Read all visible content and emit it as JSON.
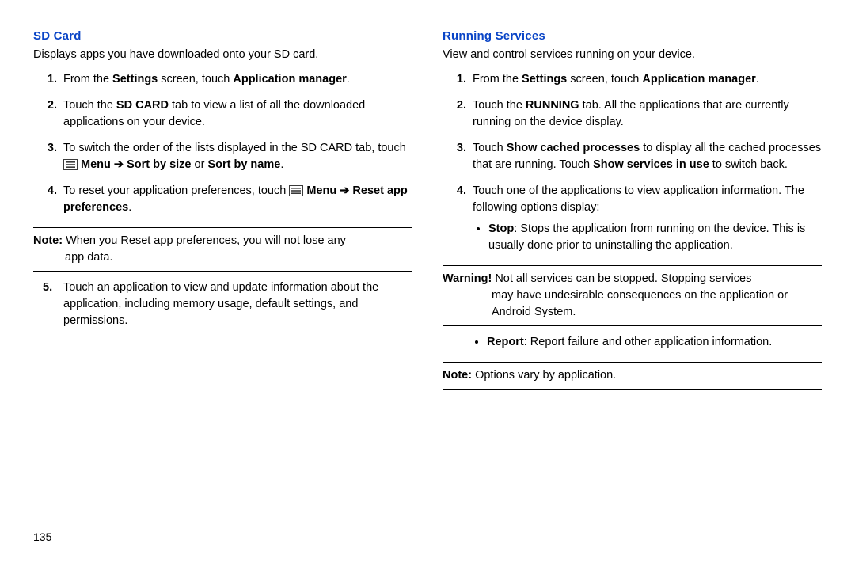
{
  "left": {
    "heading": "SD Card",
    "intro": "Displays apps you have downloaded onto your SD card.",
    "s1a": "From the ",
    "s1b": "Settings",
    "s1c": " screen, touch ",
    "s1d": "Application manager",
    "s1e": ".",
    "s2a": "Touch the ",
    "s2b": "SD CARD",
    "s2c": " tab to view a list of all the downloaded applications on your device.",
    "s3a": "To switch the order of the lists displayed in the SD CARD tab, touch ",
    "s3menu": " Menu ",
    "s3arrow": "➔",
    "s3b": " Sort by size",
    "s3c": " or ",
    "s3d": "Sort by name",
    "s3e": ".",
    "s4a": "To reset your application preferences, touch ",
    "s4menu": " Menu ",
    "s4arrow": "➔",
    "s4b": " Reset app preferences",
    "s4c": ".",
    "noteLabel": "Note:",
    "noteLine1": " When you Reset app preferences, you will not lose any",
    "noteLine2": "app data.",
    "s5": "Touch an application to view and update information about the application, including memory usage, default settings, and permissions."
  },
  "right": {
    "heading": "Running Services",
    "intro": "View and control services running on your device.",
    "s1a": "From the ",
    "s1b": "Settings",
    "s1c": " screen, touch ",
    "s1d": "Application manager",
    "s1e": ".",
    "s2a": "Touch the ",
    "s2b": "RUNNING",
    "s2c": " tab. All the applications that are currently running on the device display.",
    "s3a": "Touch ",
    "s3b": "Show cached processes",
    "s3c": " to display all the cached processes that are running. Touch ",
    "s3d": "Show services in use",
    "s3e": " to switch back.",
    "s4": "Touch one of the applications to view application information. The following options display:",
    "stopLabel": "Stop",
    "stopText": ": Stops the application from running on the device. This is usually done prior to uninstalling the application.",
    "warnLabel": "Warning!",
    "warnLine1": " Not all services can be stopped. Stopping services",
    "warnLine2": "may have undesirable consequences on the application or Android System.",
    "reportLabel": "Report",
    "reportText": ": Report failure and other application information.",
    "note2Label": "Note:",
    "note2Text": " Options vary by application."
  },
  "pageNumber": "135"
}
